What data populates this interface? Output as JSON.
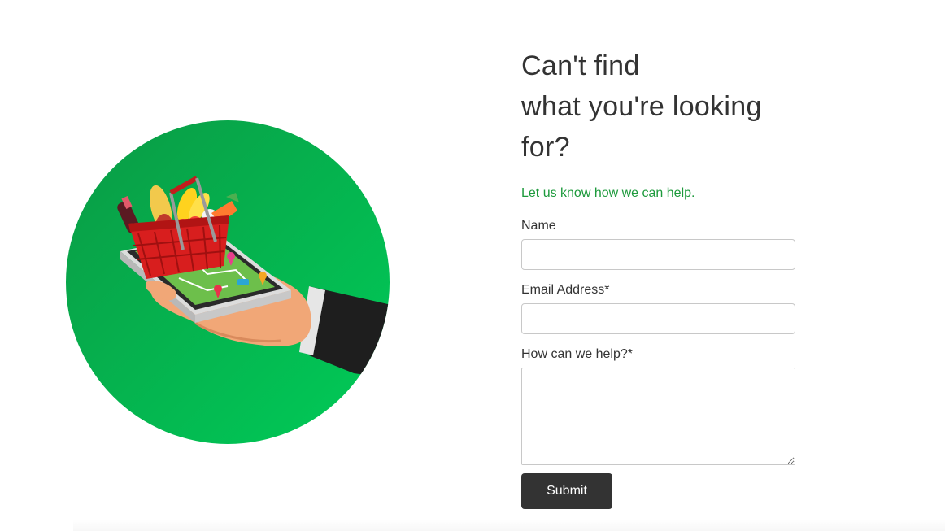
{
  "hero": {
    "heading_line1": "Can't find",
    "heading_line2": "what you're looking",
    "heading_line3": "for?",
    "subtitle": "Let us know how we can help.",
    "accent_color": "#1d9a3c",
    "illustration": "grocery-basket-on-phone-icon"
  },
  "form": {
    "name_label": "Name",
    "name_value": "",
    "email_label": "Email Address*",
    "email_value": "",
    "help_label": "How can we help?*",
    "help_value": "",
    "submit_label": "Submit",
    "button_color": "#333333"
  }
}
